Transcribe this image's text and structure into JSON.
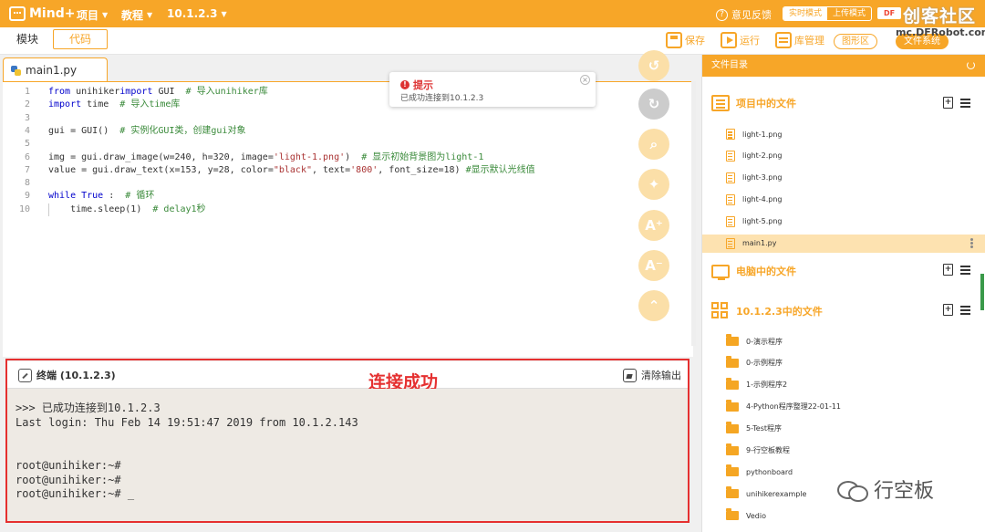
{
  "topbar": {
    "brand": "Mind+",
    "menus": [
      "项目",
      "教程",
      "10.1.2.3"
    ],
    "feedback": "意见反馈",
    "modes": [
      "实时模式",
      "上传模式"
    ],
    "site_badge": "DF",
    "site_name": "创客社区",
    "site_url": "mc.DFRobot.com.cn"
  },
  "toolbar": {
    "tab_blocks": "模块",
    "tab_code": "代码",
    "save": "保存",
    "run": "运行",
    "library": "库管理",
    "graphics": "图形区",
    "filesystem": "文件系统"
  },
  "editor": {
    "file_tab": "main1.py",
    "lines": [
      {
        "n": "1",
        "parts": [
          [
            "kw",
            "from"
          ],
          [
            "",
            "unihiker"
          ],
          [
            "kw",
            "import"
          ],
          [
            "",
            "GUI  "
          ],
          [
            "cm",
            "# 导入unihiker库"
          ]
        ]
      },
      {
        "n": "2",
        "parts": [
          [
            "kw",
            "import"
          ],
          [
            "",
            "time  "
          ],
          [
            "cm",
            "# 导入time库"
          ]
        ]
      },
      {
        "n": "3",
        "parts": []
      },
      {
        "n": "4",
        "parts": [
          [
            "",
            "gui = GUI()  "
          ],
          [
            "cm",
            "# 实例化GUI类，创建gui对象"
          ]
        ]
      },
      {
        "n": "5",
        "parts": []
      },
      {
        "n": "6",
        "parts": [
          [
            "",
            "img = gui.draw_image(w=240, h=320, image="
          ],
          [
            "st",
            "'light-1.png'"
          ],
          [
            "",
            ")  "
          ],
          [
            "cm",
            "# 显示初始背景图为light-1"
          ]
        ]
      },
      {
        "n": "7",
        "parts": [
          [
            "",
            "value = gui.draw_text(x=153, y=28, color="
          ],
          [
            "st",
            "\"black\""
          ],
          [
            "",
            ", text="
          ],
          [
            "st",
            "'800'"
          ],
          [
            "",
            ", font_size=18) "
          ],
          [
            "cm",
            "#显示默认光线值"
          ]
        ]
      },
      {
        "n": "8",
        "parts": []
      },
      {
        "n": "9",
        "parts": [
          [
            "kw",
            "while"
          ],
          [
            "kw",
            "True"
          ],
          [
            "",
            ":  "
          ],
          [
            "cm",
            "# 循环"
          ]
        ]
      },
      {
        "n": "10",
        "parts": [
          [
            "",
            "    time.sleep(1)  "
          ],
          [
            "cm",
            "# delay1秒"
          ]
        ]
      }
    ]
  },
  "hint": {
    "title": "提示",
    "body": "已成功连接到10.1.2.3"
  },
  "terminal": {
    "title": "终端 (10.1.2.3)",
    "clear": "清除输出",
    "caption": "连接成功",
    "lines": [
      ">>> 已成功连接到10.1.2.3",
      "Last login: Thu Feb 14 19:51:47 2019 from 10.1.2.143",
      "",
      "",
      "root@unihiker:~#",
      "root@unihiker:~#",
      "root@unihiker:~# _"
    ]
  },
  "panel": {
    "title": "文件目录",
    "section_project": "项目中的文件",
    "project_files": [
      "light-1.png",
      "light-2.png",
      "light-3.png",
      "light-4.png",
      "light-5.png",
      "main1.py"
    ],
    "selected_file": "main1.py",
    "section_pc": "电脑中的文件",
    "section_device": "10.1.2.3中的文件",
    "device_folders": [
      "0-演示程序",
      "0-示例程序",
      "1-示例程序2",
      "4-Python程序整理22-01-11",
      "5-Test程序",
      "9-行空板教程",
      "pythonboard",
      "unihikerexample",
      "Vedio"
    ]
  },
  "watermark": "行空板",
  "colors": {
    "accent": "#f7a628",
    "alert": "#e53030",
    "selected_row": "#fde2b0",
    "terminal_bg": "#eeeae4"
  }
}
